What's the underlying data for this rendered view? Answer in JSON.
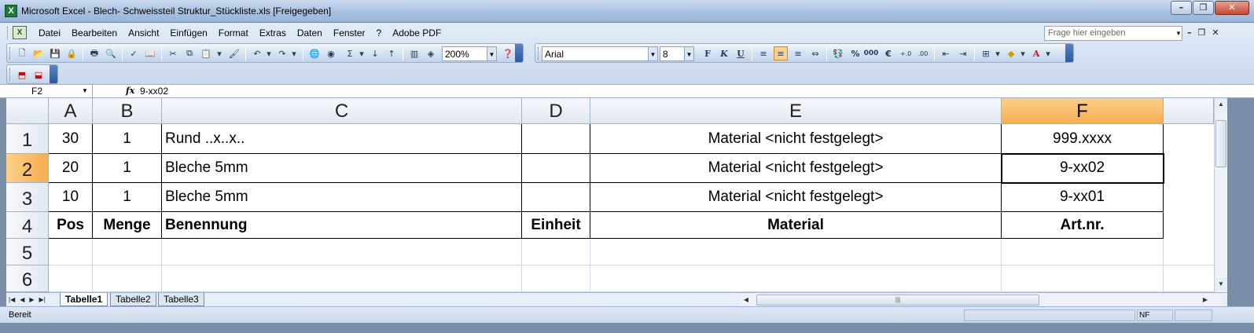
{
  "window": {
    "title": "Microsoft Excel - Blech- Schweissteil Struktur_Stückliste.xls  [Freigegeben]",
    "app_icon": "X",
    "controls": [
      "–",
      "❐",
      "✕"
    ]
  },
  "menu": {
    "items": [
      "Datei",
      "Bearbeiten",
      "Ansicht",
      "Einfügen",
      "Format",
      "Extras",
      "Daten",
      "Fenster",
      "?",
      "Adobe PDF"
    ],
    "help_placeholder": "Frage hier eingeben",
    "mdi_controls": [
      "–",
      "❐",
      "✕"
    ]
  },
  "toolbar_standard": {
    "zoom": "200%",
    "icons": [
      "new-icon",
      "open-icon",
      "save-icon",
      "permission-icon",
      "print-icon",
      "print-preview-icon",
      "spelling-icon",
      "research-icon",
      "cut-icon",
      "copy-icon",
      "paste-icon",
      "format-painter-icon",
      "undo-icon",
      "redo-icon",
      "hyperlink-icon",
      "autosum-icon",
      "sort-asc-icon",
      "sort-desc-icon",
      "chart-icon",
      "drawing-icon",
      "help-icon"
    ]
  },
  "toolbar_format": {
    "font": "Arial",
    "size": "8",
    "bold": "F",
    "italic": "K",
    "underline": "U",
    "percent": "%",
    "thousands": "000",
    "euro": "€"
  },
  "formula_bar": {
    "name_box": "F2",
    "fx": "fx",
    "formula": "9-xx02"
  },
  "columns": [
    "A",
    "B",
    "C",
    "D",
    "E",
    "F"
  ],
  "active_column": "F",
  "active_row": "2",
  "rows": [
    {
      "num": "1",
      "A": "30",
      "B": "1",
      "C": "Rund ..x..x..",
      "D": "",
      "E": "Material <nicht festgelegt>",
      "F": "999.xxxx"
    },
    {
      "num": "2",
      "A": "20",
      "B": "1",
      "C": "Bleche 5mm",
      "D": "",
      "E": "Material <nicht festgelegt>",
      "F": "9-xx02"
    },
    {
      "num": "3",
      "A": "10",
      "B": "1",
      "C": "Bleche 5mm",
      "D": "",
      "E": "Material <nicht festgelegt>",
      "F": "9-xx01"
    },
    {
      "num": "4",
      "A": "Pos",
      "B": "Menge",
      "C": "Benennung",
      "D": "Einheit",
      "E": "Material",
      "F": "Art.nr."
    },
    {
      "num": "5",
      "A": "",
      "B": "",
      "C": "",
      "D": "",
      "E": "",
      "F": ""
    },
    {
      "num": "6",
      "A": "",
      "B": "",
      "C": "",
      "D": "",
      "E": "",
      "F": ""
    }
  ],
  "sheets": [
    "Tabelle1",
    "Tabelle2",
    "Tabelle3"
  ],
  "active_sheet": "Tabelle1",
  "status": {
    "text": "Bereit",
    "num_lock": "NF"
  },
  "colors": {
    "active_header": "#f7ad52",
    "grid": "#d0d7e5",
    "header_bg": "#e2e9f3"
  }
}
